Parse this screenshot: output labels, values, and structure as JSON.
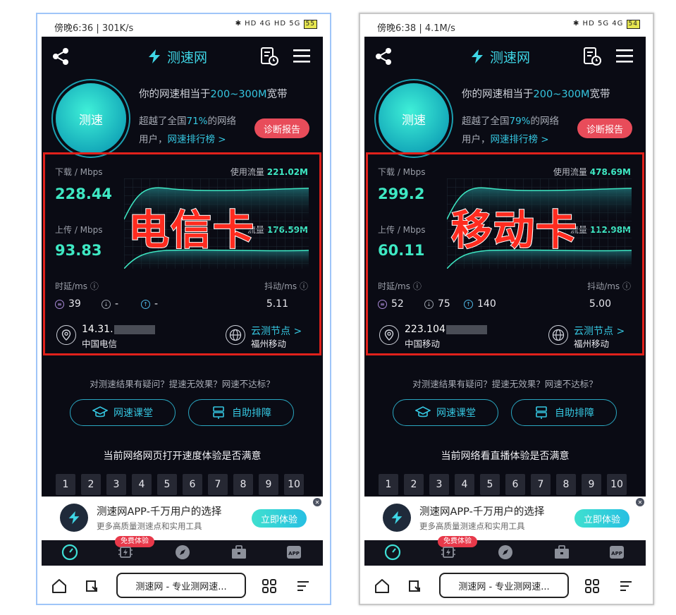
{
  "phones": [
    {
      "status": {
        "time_text": "傍晚6:36 | 301K/s",
        "icons_text": "✱ HD 4G HD 5G",
        "battery": "55"
      },
      "app_title": "测速网",
      "circle_label": "测速",
      "summary": {
        "prefix": "你的网速相当于",
        "range": "200~300M",
        "suffix": "宽带",
        "beat_prefix": "超越了全国",
        "beat_pct": "71%",
        "beat_suffix": "的网络",
        "user_prefix": "用户，",
        "rank_link": "网速排行榜 >"
      },
      "diag_button": "诊断报告",
      "download": {
        "label": "下载 / Mbps",
        "value": "228.44",
        "usage_label": "使用流量",
        "usage": "221.02M"
      },
      "upload": {
        "label": "上传 / Mbps",
        "value": "93.83",
        "usage_label": "流量",
        "usage": "176.59M"
      },
      "overlay": "电信卡",
      "latency": {
        "label": "时延/ms",
        "ping": "39",
        "down": "-",
        "up": "-"
      },
      "jitter": {
        "label": "抖动/ms",
        "value": "5.11"
      },
      "ip": {
        "prefix": "14.31.",
        "isp": "中国电信"
      },
      "node": {
        "link": "云测节点 >",
        "name": "福州移动"
      },
      "question": "对测速结果有疑问？提速无效果？网速不达标？",
      "buttons": {
        "course": "网速课堂",
        "self_help": "自助排障"
      },
      "survey": "当前网络网页打开速度体验是否满意",
      "ratings": [
        "1",
        "2",
        "3",
        "4",
        "5",
        "6",
        "7",
        "8",
        "9",
        "10"
      ],
      "ad": {
        "title": "测速网APP-千万用户的选择",
        "sub": "更多高质量测速点和实用工具",
        "button": "立即体验",
        "close": "✕"
      },
      "free_badge": "免费体验",
      "tabs": [
        "测网速",
        "提网速",
        "发现",
        "工具箱",
        "Apps"
      ],
      "url": "测速网 - 专业测网速..."
    },
    {
      "status": {
        "time_text": "傍晚6:38 | 4.1M/s",
        "icons_text": "✱ HD 5G 4G",
        "battery": "54"
      },
      "app_title": "测速网",
      "circle_label": "测速",
      "summary": {
        "prefix": "你的网速相当于",
        "range": "200~300M",
        "suffix": "宽带",
        "beat_prefix": "超越了全国",
        "beat_pct": "79%",
        "beat_suffix": "的网络",
        "user_prefix": "用户，",
        "rank_link": "网速排行榜 >"
      },
      "diag_button": "诊断报告",
      "download": {
        "label": "下载 / Mbps",
        "value": "299.2",
        "usage_label": "使用流量",
        "usage": "478.69M"
      },
      "upload": {
        "label": "上传 / Mbps",
        "value": "60.11",
        "usage_label": "流量",
        "usage": "112.98M"
      },
      "overlay": "移动卡",
      "latency": {
        "label": "时延/ms",
        "ping": "52",
        "down": "75",
        "up": "140"
      },
      "jitter": {
        "label": "抖动/ms",
        "value": "5.00"
      },
      "ip": {
        "prefix": "223.104",
        "isp": "中国移动"
      },
      "node": {
        "link": "云测节点 >",
        "name": "福州移动"
      },
      "question": "对测速结果有疑问？提速无效果？网速不达标？",
      "buttons": {
        "course": "网速课堂",
        "self_help": "自助排障"
      },
      "survey": "当前网络看直播体验是否满意",
      "ratings": [
        "1",
        "2",
        "3",
        "4",
        "5",
        "6",
        "7",
        "8",
        "9",
        "10"
      ],
      "ad": {
        "title": "测速网APP-千万用户的选择",
        "sub": "更多高质量测速点和实用工具",
        "button": "立即体验",
        "close": "✕"
      },
      "free_badge": "免费体验",
      "tabs": [
        "测网速",
        "提网速",
        "发现",
        "工具箱",
        "Apps"
      ],
      "url": "测速网 - 专业测网速..."
    }
  ],
  "colors": {
    "accent": "#3ee8c3",
    "link": "#35c6e0",
    "highlight_box": "#e1211b",
    "overlay_text": "#ff2b1f",
    "diag_button": "#e84c5a",
    "background": "#0a0b14"
  }
}
